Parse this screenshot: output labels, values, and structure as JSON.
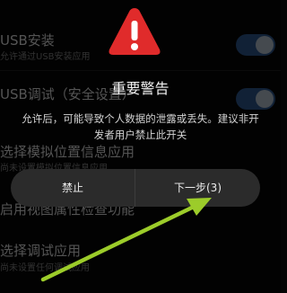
{
  "settings": {
    "items": [
      {
        "title": "USB安装",
        "subtitle": "允许通过USB安装应用",
        "toggle": true
      },
      {
        "title": "USB调试（安全设置）",
        "subtitle": "",
        "toggle": true
      },
      {
        "title": "选择模拟位置信息应用",
        "subtitle": "尚未设置模拟位置信息应用"
      },
      {
        "title": "启用视图属性检查功能",
        "subtitle": ""
      },
      {
        "title": "选择调试应用",
        "subtitle": "尚未设置任何调试应用"
      }
    ]
  },
  "dialog": {
    "icon": "warning-triangle-icon",
    "title": "重要警告",
    "message": "允许后，可能导致个人数据的泄露或丢失。建议非开发者用户禁止此开关",
    "cancel_label": "禁止",
    "next_label": "下一步(3)"
  },
  "colors": {
    "warning_red": "#e02b2b",
    "toggle_track": "#1f3c63",
    "arrow_green": "#9ccc2a"
  }
}
